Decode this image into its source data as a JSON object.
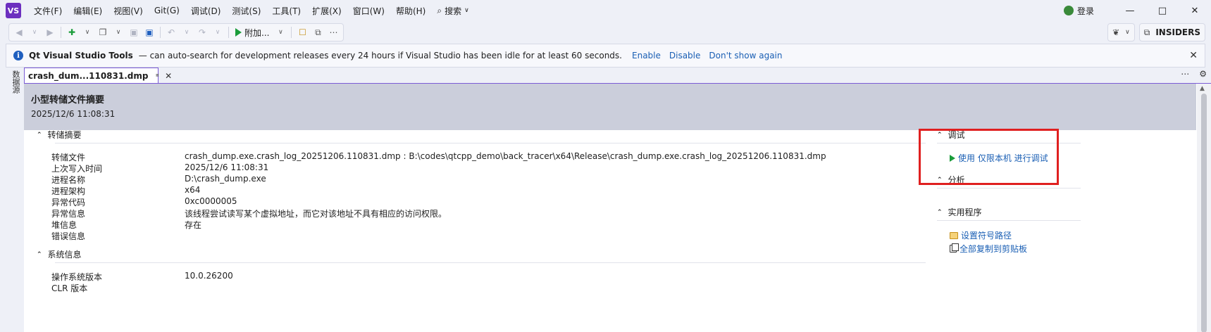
{
  "menubar": {
    "logo_text": "VS",
    "items": [
      "文件(F)",
      "编辑(E)",
      "视图(V)",
      "Git(G)",
      "调试(D)",
      "测试(S)",
      "工具(T)",
      "扩展(X)",
      "窗口(W)",
      "帮助(H)"
    ],
    "search_label": "搜索",
    "login_label": "登录"
  },
  "toolbar": {
    "run_label": "附加...",
    "insiders_label": "INSIDERS"
  },
  "infobar": {
    "title": "Qt Visual Studio Tools",
    "message": "— can auto-search for development releases every 24 hours if Visual Studio has been idle for at least 60 seconds.",
    "links": [
      "Enable",
      "Disable",
      "Don't show again"
    ]
  },
  "sidebar": {
    "vertical_label": "数据源"
  },
  "tab": {
    "label": "crash_dum...110831.dmp"
  },
  "summary": {
    "title": "小型转储文件摘要",
    "date": "2025/12/6 11:08:31"
  },
  "dump_summary": {
    "heading": "转储摘要",
    "rows": [
      {
        "label": "转储文件",
        "value": "crash_dump.exe.crash_log_20251206.110831.dmp : B:\\codes\\qtcpp_demo\\back_tracer\\x64\\Release\\crash_dump.exe.crash_log_20251206.110831.dmp"
      },
      {
        "label": "上次写入时间",
        "value": "2025/12/6 11:08:31"
      },
      {
        "label": "进程名称",
        "value": "D:\\crash_dump.exe"
      },
      {
        "label": "进程架构",
        "value": "x64"
      },
      {
        "label": "异常代码",
        "value": "0xc0000005"
      },
      {
        "label": "异常信息",
        "value": "该线程尝试读写某个虚拟地址，而它对该地址不具有相应的访问权限。"
      },
      {
        "label": "堆信息",
        "value": "存在"
      },
      {
        "label": "错误信息",
        "value": ""
      }
    ]
  },
  "system_info": {
    "heading": "系统信息",
    "rows": [
      {
        "label": "操作系统版本",
        "value": "10.0.26200"
      },
      {
        "label": "CLR 版本",
        "value": ""
      }
    ]
  },
  "right_panel": {
    "debug_heading": "调试",
    "debug_action": "使用 仅限本机 进行调试",
    "analysis_heading": "分析",
    "utilities_heading": "实用程序",
    "set_symbol_path": "设置符号路径",
    "copy_all": "全部复制到剪贴板"
  },
  "colors": {
    "accent_purple": "#7b5bd6",
    "highlight_red": "#e02020",
    "link_blue": "#1a5fb4",
    "run_green": "#1a9c3a"
  }
}
